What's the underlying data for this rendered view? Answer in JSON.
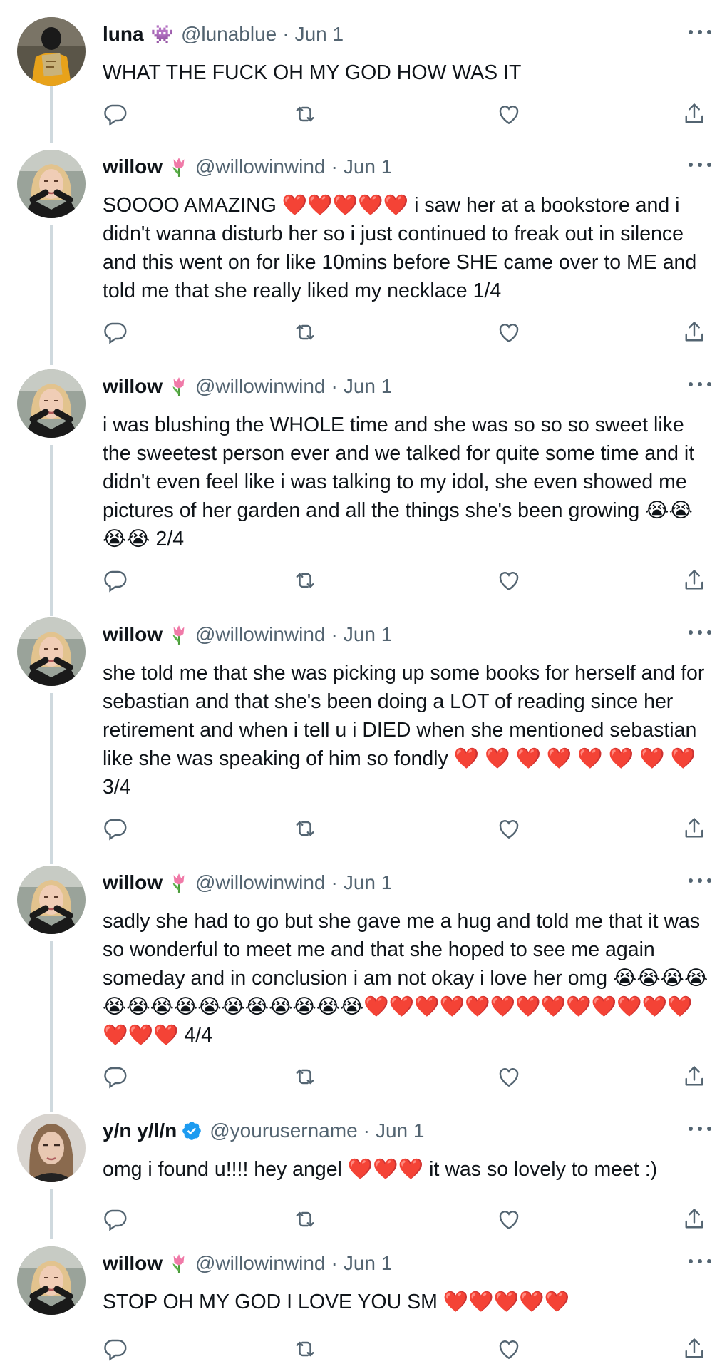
{
  "tweets": [
    {
      "name": "luna",
      "name_emoji": "👾",
      "handle": "@lunablue",
      "date": "Jun 1",
      "text": "WHAT THE FUCK OH MY GOD HOW WAS IT",
      "avatar": "luna-avatar",
      "verified": false
    },
    {
      "name": "willow",
      "name_emoji": "🌷",
      "handle": "@willowinwind",
      "date": "Jun 1",
      "text": "SOOOO AMAZING ❤️❤️❤️❤️❤️ i saw her at a bookstore and i didn't wanna disturb her so i just continued to freak out in silence and this went on for like 10mins before SHE came over to ME and told me that she really liked my necklace 1/4",
      "avatar": "willow-avatar",
      "verified": false
    },
    {
      "name": "willow",
      "name_emoji": "🌷",
      "handle": "@willowinwind",
      "date": "Jun 1",
      "text": "i was blushing the WHOLE time and she was so so so sweet like the sweetest person ever and we talked for quite some time and it didn't even feel like i was talking to my idol, she even showed me pictures of her garden and all the things she's been growing 😭😭😭😭 2/4",
      "avatar": "willow-avatar",
      "verified": false
    },
    {
      "name": "willow",
      "name_emoji": "🌷",
      "handle": "@willowinwind",
      "date": "Jun 1",
      "text": "she told me that she was picking up some books for herself and for sebastian and that she's been doing a LOT of reading since her retirement and when i tell u i DIED when she mentioned sebastian like she was speaking of him so fondly ❤️ ❤️ ❤️ ❤️ ❤️ ❤️ ❤️ ❤️ 3/4",
      "avatar": "willow-avatar",
      "verified": false
    },
    {
      "name": "willow",
      "name_emoji": "🌷",
      "handle": "@willowinwind",
      "date": "Jun 1",
      "text": "sadly she had to go but she gave me a hug and told me that it was so wonderful to meet me and that she hoped to see me again someday and in conclusion i am not okay i love her omg 😭😭😭😭😭😭😭😭😭😭😭😭😭😭😭❤️❤️❤️❤️❤️❤️❤️❤️❤️❤️❤️❤️❤️❤️❤️❤️ 4/4",
      "avatar": "willow-avatar",
      "verified": false
    },
    {
      "name": "y/n y/l/n",
      "name_emoji": "",
      "handle": "@yourusername",
      "date": "Jun 1",
      "text": "omg i found u!!!! hey angel ❤️❤️❤️ it was so lovely to meet :)",
      "avatar": "yn-avatar",
      "verified": true
    },
    {
      "name": "willow",
      "name_emoji": "🌷",
      "handle": "@willowinwind",
      "date": "Jun 1",
      "text": "STOP OH MY GOD I LOVE YOU SM ❤️❤️❤️❤️❤️",
      "avatar": "willow-avatar",
      "verified": false
    }
  ],
  "icons": {
    "reply": "reply-icon",
    "retweet": "retweet-icon",
    "like": "like-icon",
    "share": "share-icon",
    "more": "more-icon",
    "verified": "verified-badge-icon"
  },
  "colors": {
    "text": "#0f1419",
    "secondary": "#536471",
    "thread_line": "#cfd9de",
    "verified": "#1d9bf0"
  }
}
